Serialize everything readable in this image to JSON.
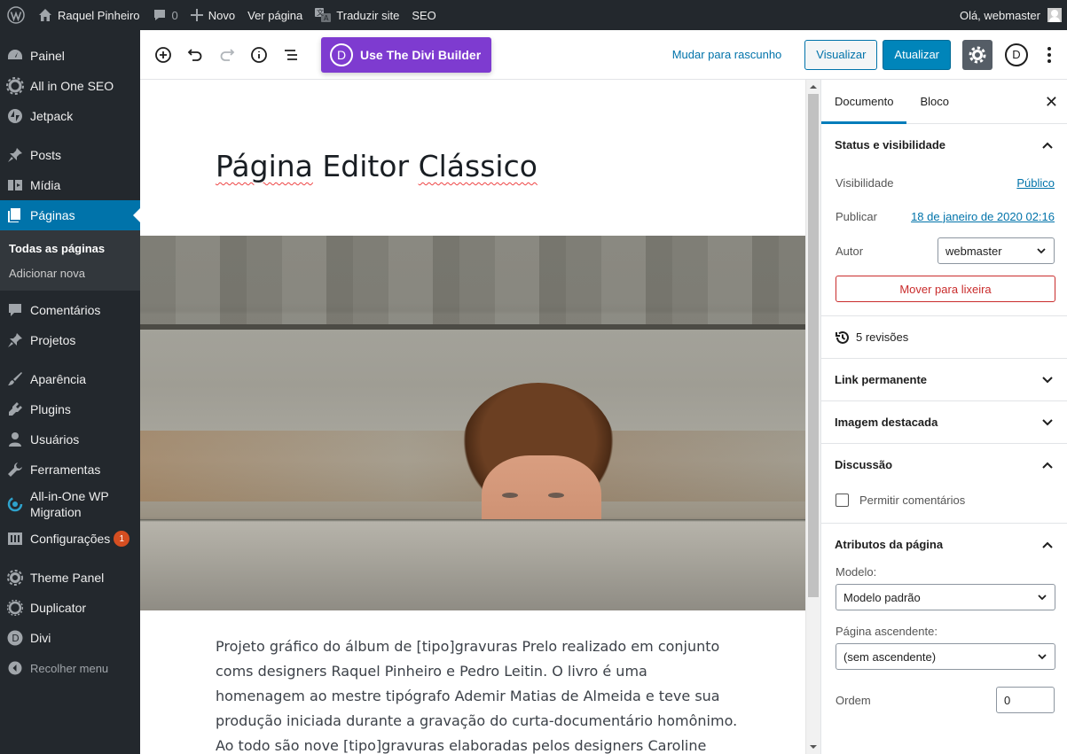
{
  "adminbar": {
    "site_name": "Raquel Pinheiro",
    "comments_count": "0",
    "new_label": "Novo",
    "view_label": "Ver página",
    "translate_label": "Traduzir site",
    "seo_label": "SEO",
    "greeting": "Olá, webmaster"
  },
  "menu": {
    "painel": "Painel",
    "aioseo": "All in One SEO",
    "jetpack": "Jetpack",
    "posts": "Posts",
    "midia": "Mídia",
    "paginas": "Páginas",
    "sub_all": "Todas as páginas",
    "sub_new": "Adicionar nova",
    "comentarios": "Comentários",
    "projetos": "Projetos",
    "aparencia": "Aparência",
    "plugins": "Plugins",
    "usuarios": "Usuários",
    "ferramentas": "Ferramentas",
    "migration_1": "All-in-One WP",
    "migration_2": "Migration",
    "configuracoes": "Configurações",
    "config_badge": "1",
    "theme_panel": "Theme Panel",
    "duplicator": "Duplicator",
    "divi": "Divi",
    "collapse": "Recolher menu"
  },
  "toolbar": {
    "divi_logo": "D",
    "divi_label": "Use The Divi Builder",
    "draft_label": "Mudar para rascunho",
    "preview_label": "Visualizar",
    "update_label": "Atualizar",
    "divi_circle": "D"
  },
  "post": {
    "title_a": "Página",
    "title_b": "Editor",
    "title_c": "Clássico",
    "body": " Projeto gráfico do álbum de [tipo]gravuras Prelo realizado em conjunto coms designers Raquel Pinheiro e Pedro Leitin. O livro é uma homenagem ao mestre tipógrafo Ademir Matias de Almeida e teve sua produção iniciada durante a gravação do curta-documentário homônimo. Ao todo são nove [tipo]gravuras elaboradas pelos designers Caroline Gischewski, Fábio Martins,"
  },
  "sidebar": {
    "tab_document": "Documento",
    "tab_block": "Bloco",
    "close": "✕",
    "status_title": "Status e visibilidade",
    "visibility_label": "Visibilidade",
    "visibility_value": "Público",
    "publish_label": "Publicar",
    "publish_value": "18 de janeiro de 2020 02:16",
    "author_label": "Autor",
    "author_value": "webmaster",
    "trash_label": "Mover para lixeira",
    "revisions": "5 revisões",
    "permalink": "Link permanente",
    "featured_image": "Imagem destacada",
    "discussion": "Discussão",
    "allow_comments": "Permitir comentários",
    "page_attributes": "Atributos da página",
    "template_label": "Modelo:",
    "template_value": "Modelo padrão",
    "parent_label": "Página ascendente:",
    "parent_value": "(sem ascendente)",
    "order_label": "Ordem",
    "order_value": "0"
  },
  "colors": {
    "adminbar_bg": "#23282d",
    "menu_active": "#0073aa",
    "divi_purple": "#7e3bd0",
    "update_blue": "#0085ba",
    "trash_red": "#c92c2c"
  }
}
